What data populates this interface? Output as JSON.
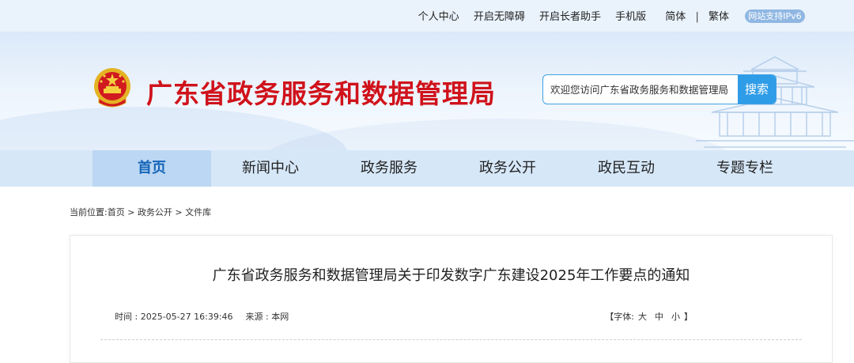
{
  "topbar": {
    "links": [
      "个人中心",
      "开启无障碍",
      "开启长者助手",
      "手机版",
      "简体",
      "繁体"
    ],
    "separator": "|",
    "ipv6_badge": "网站支持IPv6"
  },
  "header": {
    "site_title": "广东省政务服务和数据管理局",
    "search_placeholder": "欢迎您访问广东省政务服务和数据管理局",
    "search_button": "搜索"
  },
  "nav": {
    "items": [
      "首页",
      "新闻中心",
      "政务服务",
      "政务公开",
      "政民互动",
      "专题专栏"
    ],
    "active_index": 0
  },
  "breadcrumb": {
    "prefix": "当前位置:",
    "items": [
      "首页",
      "政务公开",
      "文件库"
    ],
    "separator": " > "
  },
  "article": {
    "title": "广东省政务服务和数据管理局关于印发数字广东建设2025年工作要点的通知",
    "time": "时间 : 2025-05-27 16:39:46",
    "source": "来源 : 本网",
    "font_label_open": "【字体:",
    "font_large": "大",
    "font_medium": "中",
    "font_small": "小",
    "font_label_close": "】"
  },
  "colors": {
    "title_red": "#d0121b",
    "accent_blue": "#2f9ce8",
    "nav_bg": "#d6e7f8",
    "nav_active": "#bcd7f3"
  },
  "icons": [
    "national-emblem-icon",
    "temple-building-illustration"
  ]
}
